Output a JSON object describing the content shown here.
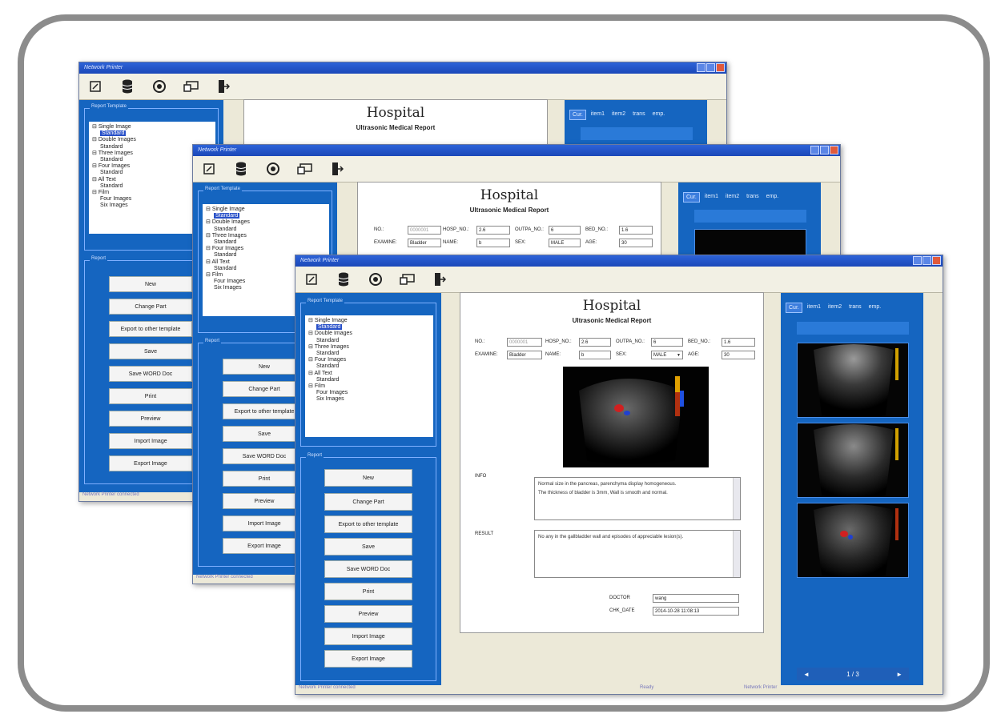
{
  "window": {
    "title": "Network Printer"
  },
  "toolbar": {
    "icons": [
      "edit-icon",
      "database-icon",
      "settings-icon",
      "monitor-icon",
      "exit-icon"
    ]
  },
  "report_template": {
    "title": "Report Template",
    "items": [
      {
        "label": "Single Image",
        "children": [
          "Standard"
        ]
      },
      {
        "label": "Double Images",
        "children": [
          "Standard"
        ]
      },
      {
        "label": "Three Images",
        "children": [
          "Standard"
        ]
      },
      {
        "label": "Four Images",
        "children": [
          "Standard"
        ]
      },
      {
        "label": "All Text",
        "children": [
          "Standard"
        ]
      },
      {
        "label": "Film",
        "children": [
          "Four Images",
          "Six Images"
        ]
      }
    ]
  },
  "report_group": {
    "title": "Report",
    "buttons": [
      "New",
      "Change Part",
      "Export to other template",
      "Save",
      "Save WORD Doc",
      "Print",
      "Preview",
      "Import Image",
      "Export Image"
    ],
    "back_buttons": [
      "New",
      "Change Part",
      "Export to other template",
      "Save",
      "Save WORD Doc",
      "Print",
      "Preview",
      "Import Image",
      "Export Image"
    ],
    "mid_buttons": [
      "New",
      "Change Part",
      "Export to other template",
      "Save",
      "Save WORD Doc",
      "Print",
      "Preview",
      "Import Image",
      "Export Image"
    ]
  },
  "report": {
    "title": "Hospital",
    "subtitle": "Ultrasonic Medical Report",
    "fields": [
      {
        "label": "NO.:",
        "value": "0000001"
      },
      {
        "label": "HOSP_NO.:",
        "value": "2.6"
      },
      {
        "label": "OUTPA_NO.:",
        "value": "6"
      },
      {
        "label": "BED_NO.:",
        "value": "1.6"
      },
      {
        "label": "EXAMINE:",
        "value": "Bladder"
      },
      {
        "label": "NAME:",
        "value": "b"
      },
      {
        "label": "SEX:",
        "value": "MALE"
      },
      {
        "label": "AGE:",
        "value": "30"
      }
    ],
    "info_label": "INFO",
    "info_text": [
      "Normal size in the pancreas, parenchyma display homogeneous.",
      "The thickness of bladder is 3mm, Wall is smooth and normal."
    ],
    "result_label": "RESULT",
    "result_text": "No any in the gallbladder wall and episodes of appreciable lesion(s).",
    "doctor_label": "DOCTOR",
    "doctor_value": "wang",
    "date_label": "CHK_DATE",
    "date_value": "2014-10-28 11:08:13"
  },
  "image_tabs": [
    "Cur.",
    "item1",
    "item2",
    "trans",
    "emp."
  ],
  "nav": {
    "prev": "◄",
    "page": "1 / 3",
    "next": "►"
  },
  "status": {
    "left": "Network Printer connected",
    "mid": "Ready",
    "right": "Network Printer"
  }
}
